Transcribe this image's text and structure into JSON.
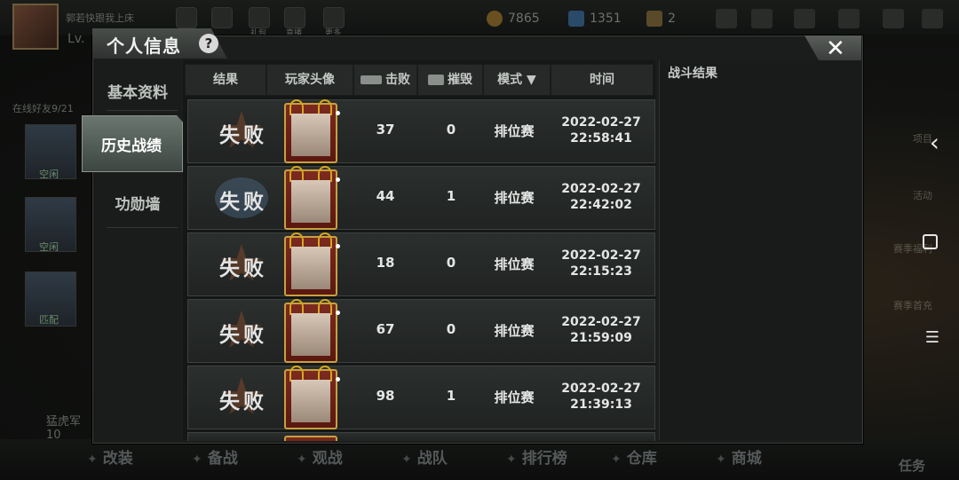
{
  "background": {
    "player_name": "郭若快跟我上床",
    "level": "Lv.",
    "top_icons": [
      "礼包",
      "直播",
      "更多"
    ],
    "coins": "7865",
    "diamonds": "1351",
    "tickets": "2",
    "friends_online": "在线好友9/21",
    "left_tiles": [
      "空闲",
      "空闲",
      "匹配"
    ],
    "chat_text": "猛虎军10",
    "bottom_nav": [
      "改装",
      "备战",
      "观战",
      "战队",
      "排行榜",
      "仓库",
      "商城"
    ],
    "right_labels": [
      "项目",
      "活动",
      "赛季福利",
      "赛季首充"
    ],
    "task_label": "任务"
  },
  "dialog": {
    "title": "个人信息",
    "help": "?",
    "close": "✕",
    "sidebar": [
      "基本资料",
      "历史战绩",
      "功勋墙"
    ],
    "active_tab": "历史战绩",
    "headers": {
      "result": "结果",
      "avatar": "玩家头像",
      "kills": "击败",
      "destroyed": "摧毁",
      "mode": "模式",
      "mode_arrow": "▼",
      "time": "时间"
    },
    "rows": [
      {
        "result": "失败",
        "kills": "37",
        "destroyed": "0",
        "mode": "排位赛",
        "date": "2022-02-27",
        "time": "22:58:41"
      },
      {
        "result": "失败",
        "kills": "44",
        "destroyed": "1",
        "mode": "排位赛",
        "date": "2022-02-27",
        "time": "22:42:02"
      },
      {
        "result": "失败",
        "kills": "18",
        "destroyed": "0",
        "mode": "排位赛",
        "date": "2022-02-27",
        "time": "22:15:23"
      },
      {
        "result": "失败",
        "kills": "67",
        "destroyed": "0",
        "mode": "排位赛",
        "date": "2022-02-27",
        "time": "21:59:09"
      },
      {
        "result": "失败",
        "kills": "98",
        "destroyed": "1",
        "mode": "排位赛",
        "date": "2022-02-27",
        "time": "21:39:13"
      }
    ],
    "battle_result_title": "战斗结果"
  },
  "system_nav": {
    "back": "‹",
    "menu": "☰"
  }
}
